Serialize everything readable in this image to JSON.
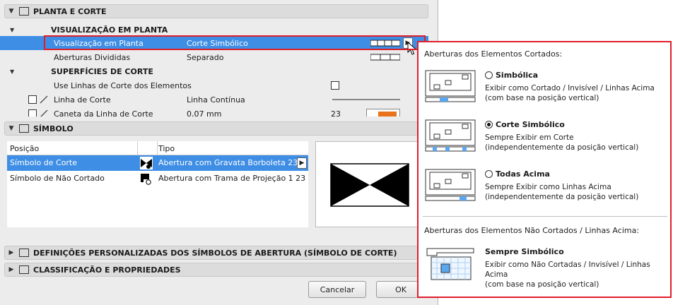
{
  "sections": {
    "planta": "PLANTA E CORTE",
    "simbolo": "SÍMBOLO",
    "definicoes": "DEFINIÇÕES PERSONALIZADAS DOS SÍMBOLOS DE ABERTURA  (SÍMBOLO DE CORTE)",
    "classificacao": "CLASSIFICAÇÃO E PROPRIEDADES"
  },
  "planta_rows": {
    "visualizacao_head": "VISUALIZAÇÃO EM PLANTA",
    "visualizacao_label": "Visualização em Planta",
    "visualizacao_value": "Corte Simbólico",
    "aberturas_label": "Aberturas Divididas",
    "aberturas_value": "Separado",
    "superficies_head": "SUPERFÍCIES DE CORTE",
    "use_linhas_label": "Use Linhas de Corte dos Elementos",
    "linha_corte_label": "Linha de Corte",
    "linha_corte_value": "Linha Contínua",
    "caneta_label": "Caneta da Linha de Corte",
    "caneta_value": "0,07 mm",
    "caneta_num": "23"
  },
  "symbol_list": {
    "col_posicao": "Posição",
    "col_tipo": "Tipo",
    "rows": [
      {
        "posicao": "Símbolo de Corte",
        "tipo": "Abertura com Gravata Borboleta 23"
      },
      {
        "posicao": "Símbolo de Não Cortado",
        "tipo": "Abertura com Trama de Projeção 1 23"
      }
    ]
  },
  "buttons": {
    "cancel": "Cancelar",
    "ok": "OK"
  },
  "popup": {
    "section1_title": "Aberturas dos Elementos Cortados:",
    "options": [
      {
        "label": "Simbólica",
        "desc1": "Exibir como Cortado / Invisível / Linhas Acima",
        "desc2": "(com base na posição vertical)",
        "selected": false
      },
      {
        "label": "Corte Simbólico",
        "desc1": "Sempre Exibir em Corte",
        "desc2": "(independentemente da posição vertical)",
        "selected": true
      },
      {
        "label": "Todas Acima",
        "desc1": "Sempre Exibir como Linhas Acima",
        "desc2": "(independentemente da posição vertical)",
        "selected": false
      }
    ],
    "section2_title": "Aberturas dos Elementos Não Cortados / Linhas Acima:",
    "uncut_option": {
      "label": "Sempre Simbólico",
      "desc1": "Exibir como Não Cortadas / Invisível / Linhas",
      "desc2": "Acima",
      "desc3": "(com base na posição vertical)"
    }
  },
  "colors": {
    "selection": "#3f8ee5",
    "highlight": "#e01e2a",
    "accent_blue": "#5aa7f0",
    "swatch_orange": "#e8731a"
  }
}
